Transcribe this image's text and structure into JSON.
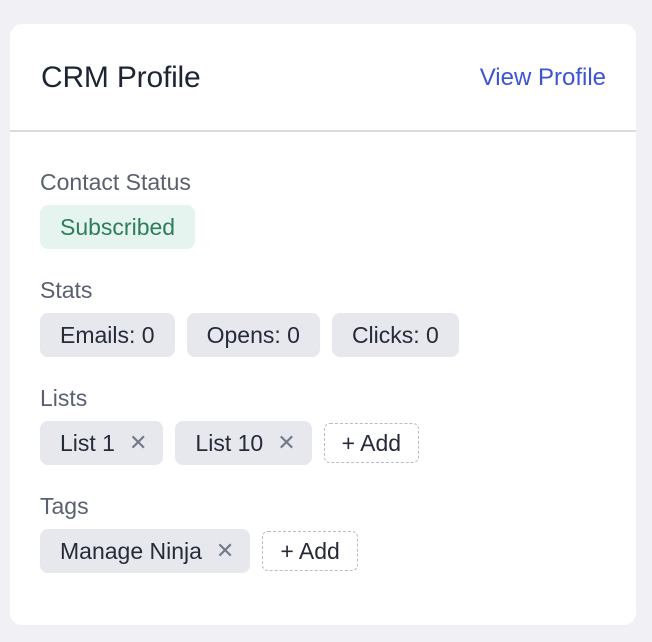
{
  "header": {
    "title": "CRM Profile",
    "view_profile_label": "View Profile"
  },
  "contact_status": {
    "label": "Contact Status",
    "value": "Subscribed",
    "color": "#2e7d5b"
  },
  "stats": {
    "label": "Stats",
    "items": [
      "Emails: 0",
      "Opens: 0",
      "Clicks: 0"
    ]
  },
  "lists": {
    "label": "Lists",
    "items": [
      "List 1",
      "List 10"
    ],
    "add_label": "+ Add"
  },
  "tags": {
    "label": "Tags",
    "items": [
      "Manage Ninja"
    ],
    "add_label": "+ Add"
  },
  "icons": {
    "remove": "close-icon"
  },
  "colors": {
    "accent": "#3d55d4"
  }
}
